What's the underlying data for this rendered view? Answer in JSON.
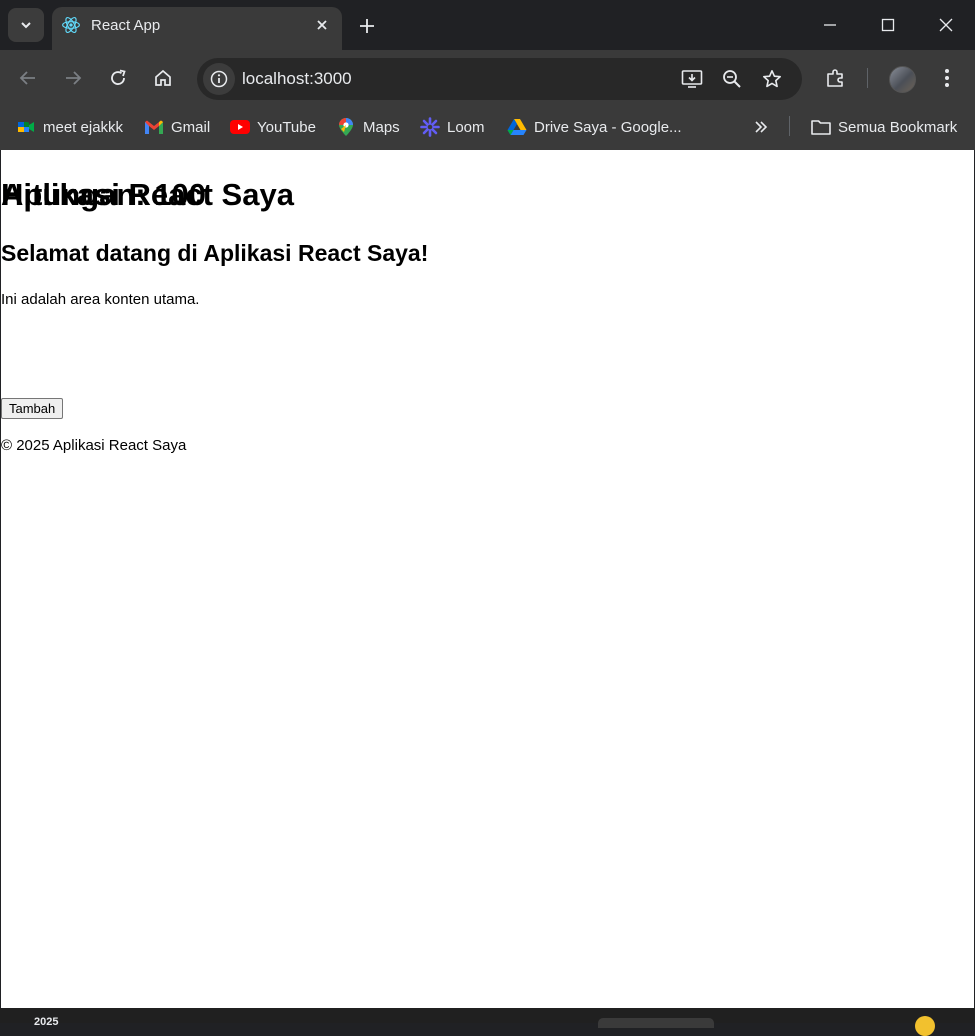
{
  "browser": {
    "tab": {
      "title": "React App"
    },
    "address_bar": {
      "url": "localhost:3000"
    },
    "bookmarks": [
      {
        "label": "meet ejakkk",
        "icon": "google-meet-icon"
      },
      {
        "label": "Gmail",
        "icon": "gmail-icon"
      },
      {
        "label": "YouTube",
        "icon": "youtube-icon"
      },
      {
        "label": "Maps",
        "icon": "maps-icon"
      },
      {
        "label": "Loom",
        "icon": "loom-icon"
      },
      {
        "label": "Drive Saya - Google...",
        "icon": "google-drive-icon"
      }
    ],
    "all_bookmarks": {
      "label": "Semua Bookmark",
      "icon": "folder-icon"
    },
    "colors": {
      "tab_strip": "#202124",
      "toolbar": "#3a3a3a",
      "omnibox": "#282828",
      "text": "#e8eaed"
    }
  },
  "page": {
    "header_title": "Aplikasi React Saya",
    "welcome_heading": "Selamat datang di Aplikasi React Saya!",
    "body_text": "Ini adalah area konten utama.",
    "counter_label": "Hitungan: 100",
    "add_button": "Tambah",
    "footer": "© 2025 Aplikasi React Saya"
  },
  "taskbar": {
    "partial_text": "2025"
  }
}
